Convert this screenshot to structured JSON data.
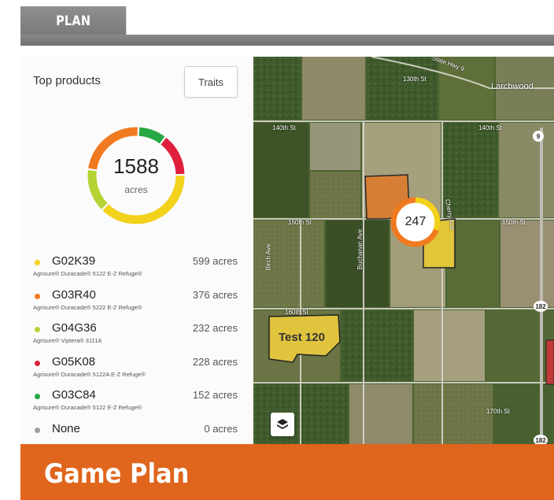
{
  "header": {
    "tab_label": "PLAN"
  },
  "panel": {
    "title": "Top products",
    "traits_button": "Traits",
    "total_value": "1588",
    "total_unit": "acres",
    "products": [
      {
        "name": "G02K39",
        "acres": "599 acres",
        "trait": "Agrisure® Duracade® 5122 E-Z Refuge®",
        "color": "#f2d21b",
        "value": 599
      },
      {
        "name": "G03R40",
        "acres": "376 acres",
        "trait": "Agrisure® Duracade® 5222 E-Z Refuge®",
        "color": "#f07a1f",
        "value": 376
      },
      {
        "name": "G04G36",
        "acres": "232 acres",
        "trait": "Agrisure® Viptera® 3111A",
        "color": "#b5d334",
        "value": 232
      },
      {
        "name": "G05K08",
        "acres": "228 acres",
        "trait": "Agrisure® Duracade® 5122A E-Z Refuge®",
        "color": "#e01f3d",
        "value": 228
      },
      {
        "name": "G03C84",
        "acres": "152 acres",
        "trait": "Agrisure® Duracade® 5122 E-Z Refuge®",
        "color": "#27a844",
        "value": 152
      },
      {
        "name": "None",
        "acres": "0 acres",
        "trait": "",
        "color": "#9e9e9e",
        "value": 0
      }
    ]
  },
  "map": {
    "marker_value": "247",
    "field_label": "Test 120",
    "roads": [
      "State Hwy 9",
      "Larchwood",
      "130th St",
      "140th St",
      "140th St",
      "150th St",
      "150th St",
      "160th St",
      "170th St",
      "Birch Ave",
      "Buchanan Ave",
      "Cherry Ave"
    ],
    "shields": [
      "9",
      "182",
      "182"
    ]
  },
  "banner": {
    "title": "Game Plan"
  }
}
